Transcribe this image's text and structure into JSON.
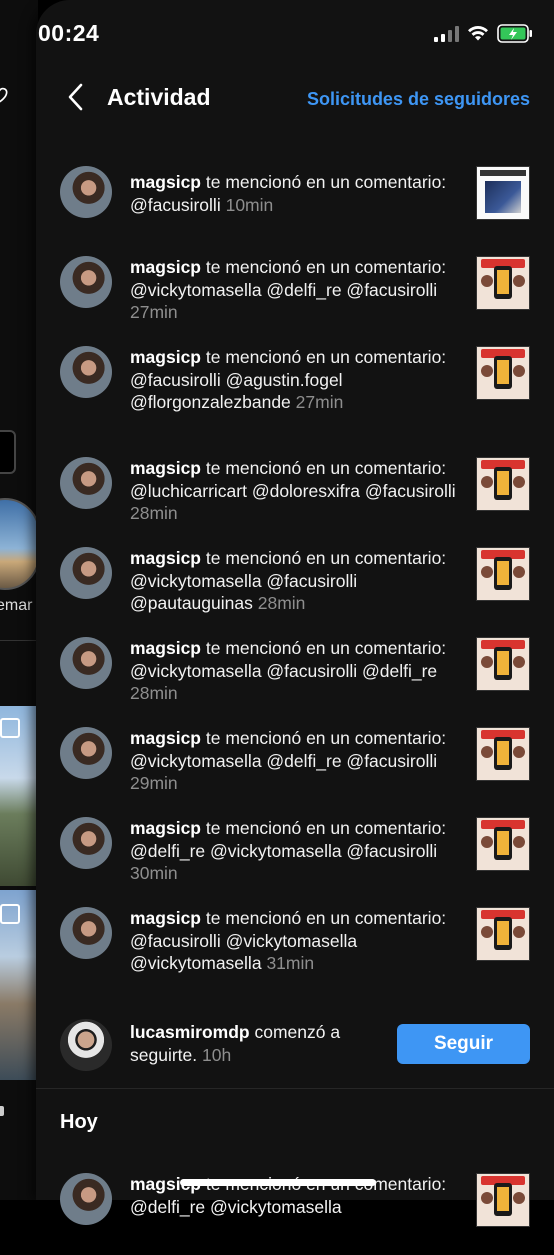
{
  "status_bar": {
    "time": "00:24"
  },
  "header": {
    "title": "Actividad",
    "follow_requests_label": "Solicitudes de seguidores"
  },
  "background_app": {
    "story_label": "emar"
  },
  "activity": [
    {
      "user": "magsicp",
      "action": "te mencionó en un comentario:",
      "mentions": "@facusirolli",
      "time": "10min"
    },
    {
      "user": "magsicp",
      "action": "te mencionó en un comentario:",
      "mentions": "@vickytomasella @delfi_re @facusirolli",
      "time": "27min"
    },
    {
      "user": "magsicp",
      "action": "te mencionó en un comentario:",
      "mentions": "@facusirolli @agustin.fogel @florgonzalezbande",
      "time": "27min"
    },
    {
      "user": "magsicp",
      "action": "te mencionó en un comentario:",
      "mentions": "@luchicarricart @doloresxifra @facusirolli",
      "time": "28min"
    },
    {
      "user": "magsicp",
      "action": "te mencionó en un comentario:",
      "mentions": "@vickytomasella @facusirolli @pautauguinas",
      "time": "28min"
    },
    {
      "user": "magsicp",
      "action": "te mencionó en un comentario:",
      "mentions": "@vickytomasella @facusirolli @delfi_re",
      "time": "28min"
    },
    {
      "user": "magsicp",
      "action": "te mencionó en un comentario:",
      "mentions": "@vickytomasella @delfi_re @facusirolli",
      "time": "29min"
    },
    {
      "user": "magsicp",
      "action": "te mencionó en un comentario:",
      "mentions": "@delfi_re @vickytomasella @facusirolli",
      "time": "30min"
    },
    {
      "user": "magsicp",
      "action": "te mencionó en un comentario:",
      "mentions": "@facusirolli @vickytomasella @vickytomasella",
      "time": "31min"
    }
  ],
  "follow_row": {
    "user": "lucasmiromdp",
    "action": "comenzó a seguirte.",
    "time": "10h",
    "button_label": "Seguir"
  },
  "section_today": {
    "title": "Hoy"
  },
  "today_first": {
    "user": "magsicp",
    "action": "te mencionó en un comentario:",
    "mentions": "@delfi_re @vickytomasella"
  },
  "colors": {
    "accent": "#3e96f4",
    "background": "#121212",
    "muted": "#8e8e8e"
  }
}
